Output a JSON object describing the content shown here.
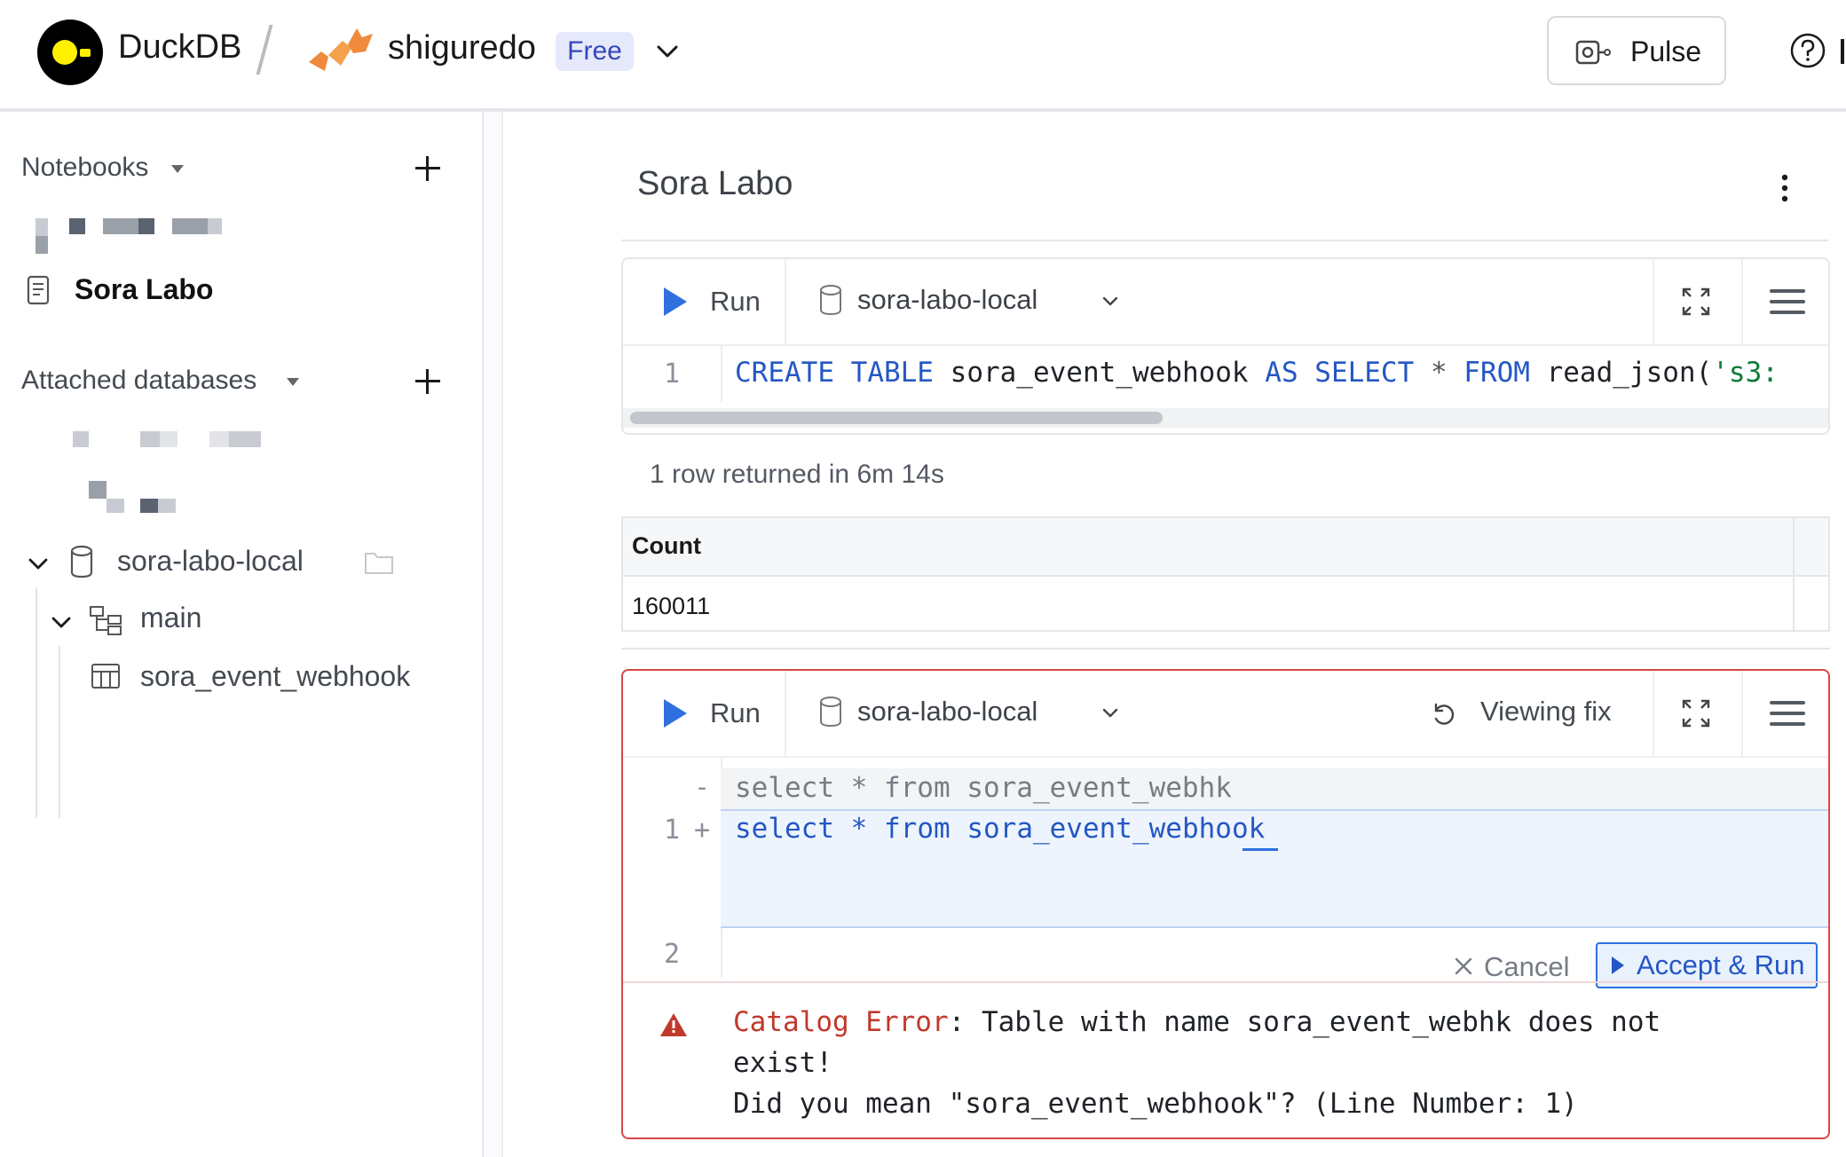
{
  "header": {
    "brand": "DuckDB",
    "org_name": "shiguredo",
    "plan_badge": "Free",
    "pulse_label": "Pulse"
  },
  "sidebar": {
    "notebooks_title": "Notebooks",
    "active_notebook": "Sora Labo",
    "attached_title": "Attached databases",
    "tree": {
      "database": "sora-labo-local",
      "schema": "main",
      "table": "sora_event_webhook"
    }
  },
  "notebook": {
    "title": "Sora Labo",
    "cells": [
      {
        "run_label": "Run",
        "database": "sora-labo-local",
        "line_number": "1",
        "code_tokens": [
          "CREATE",
          "TABLE",
          "sora_event_webhook",
          "AS",
          "SELECT",
          "*",
          "FROM",
          "read_json(",
          "'s3:"
        ],
        "result_meta": "1 row returned in 6m 14s",
        "result_columns": [
          "Count"
        ],
        "result_rows": [
          [
            "160011"
          ]
        ]
      },
      {
        "run_label": "Run",
        "database": "sora-labo-local",
        "viewing_label": "Viewing fix",
        "diff": {
          "removed_marker": "-",
          "removed_line": "select * from sora_event_webhk",
          "added_line_number": "1",
          "added_marker": "+",
          "added_tokens": [
            "select",
            "*",
            "from",
            "sora_event_webhook"
          ],
          "line2_number": "2"
        },
        "cancel_label": "Cancel",
        "accept_label": "Accept & Run",
        "error": {
          "kind": "Catalog Error",
          "message_1": ": Table with name sora_event_webhk does not",
          "message_2": "exist!",
          "message_3": "Did you mean \"sora_event_webhook\"? (Line Number: 1)"
        }
      }
    ]
  },
  "colors": {
    "accent": "#2f6fe0",
    "keyword": "#2457c5",
    "error_border": "#d94848",
    "error_text": "#c0392b",
    "logo_yellow": "#fff100"
  }
}
